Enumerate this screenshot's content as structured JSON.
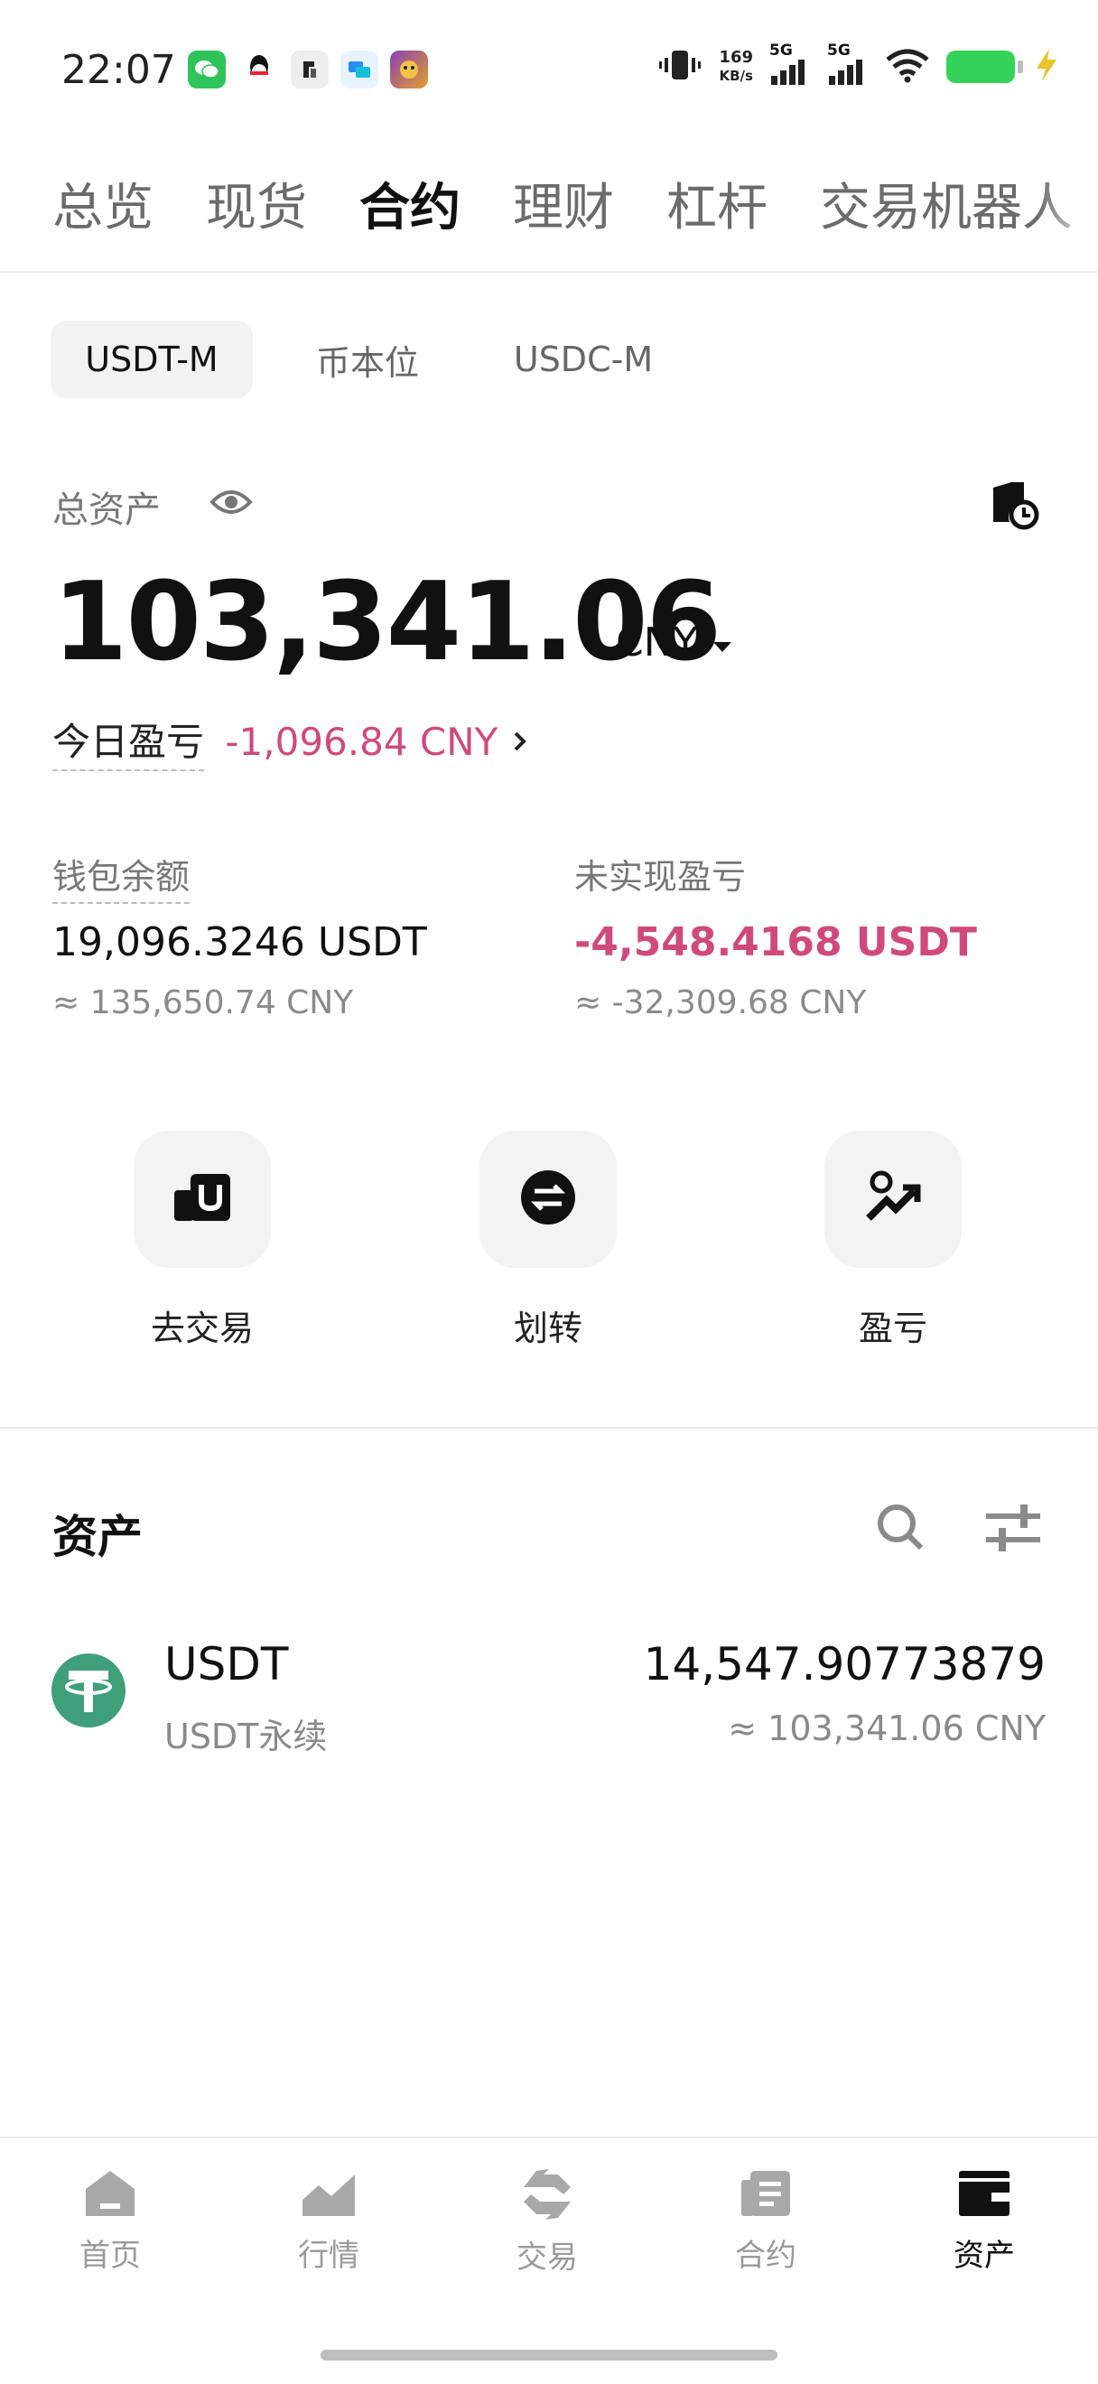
{
  "status_bar": {
    "time": "22:07",
    "net_speed_value": "169",
    "net_speed_unit": "KB/s",
    "signal_label": "5G",
    "apps": [
      "wechat-icon",
      "qq-icon",
      "app-icon",
      "chat-icon",
      "game-icon"
    ]
  },
  "top_tabs": [
    {
      "label": "总览"
    },
    {
      "label": "现货"
    },
    {
      "label": "合约",
      "active": true
    },
    {
      "label": "理财"
    },
    {
      "label": "杠杆"
    },
    {
      "label": "交易机器人"
    }
  ],
  "segments": [
    {
      "label": "USDT-M",
      "active": true
    },
    {
      "label": "币本位"
    },
    {
      "label": "USDC-M"
    }
  ],
  "summary": {
    "total_assets_label": "总资产",
    "total_value": "103,341.06",
    "currency": "CNY",
    "today_pnl_label": "今日盈亏",
    "today_pnl_value": "-1,096.84 CNY",
    "wallet_balance_label": "钱包余额",
    "wallet_balance_value": "19,096.3246 USDT",
    "wallet_balance_cny": "≈ 135,650.74 CNY",
    "unrealized_pnl_label": "未实现盈亏",
    "unrealized_pnl_value": "-4,548.4168 USDT",
    "unrealized_pnl_cny": "≈ -32,309.68 CNY"
  },
  "actions": [
    {
      "label": "去交易",
      "icon": "trade-icon"
    },
    {
      "label": "划转",
      "icon": "transfer-icon"
    },
    {
      "label": "盈亏",
      "icon": "pnl-icon"
    }
  ],
  "assets": {
    "title": "资产",
    "items": [
      {
        "symbol": "USDT",
        "sub": "USDT永续",
        "amount": "14,547.90773879",
        "cny": "≈ 103,341.06 CNY"
      }
    ]
  },
  "bottom_nav": [
    {
      "label": "首页",
      "icon": "home-icon"
    },
    {
      "label": "行情",
      "icon": "market-icon"
    },
    {
      "label": "交易",
      "icon": "trade-nav-icon"
    },
    {
      "label": "合约",
      "icon": "futures-icon"
    },
    {
      "label": "资产",
      "icon": "wallet-icon",
      "active": true
    }
  ],
  "colors": {
    "accent_red": "#cf4a7b",
    "usdt_green": "#3f9f7a",
    "battery_green": "#35d25a"
  }
}
